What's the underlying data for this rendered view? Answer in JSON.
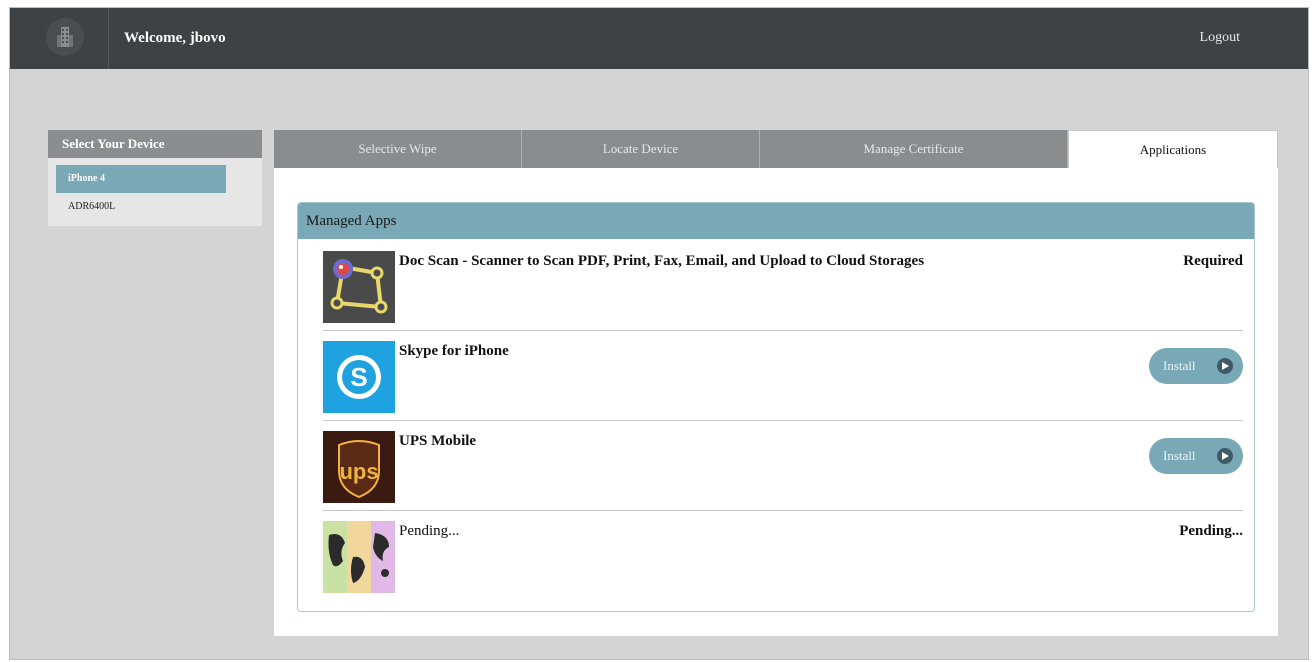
{
  "header": {
    "welcome": "Welcome, jbovo",
    "logout": "Logout"
  },
  "sidebar": {
    "title": "Select Your Device",
    "devices": [
      {
        "label": "iPhone 4",
        "selected": true
      },
      {
        "label": "ADR6400L",
        "selected": false
      }
    ]
  },
  "tabs": [
    {
      "label": "Selective Wipe",
      "active": false
    },
    {
      "label": "Locate Device",
      "active": false
    },
    {
      "label": "Manage Certificate",
      "active": false
    },
    {
      "label": "Applications",
      "active": true
    }
  ],
  "managed_apps": {
    "title": "Managed Apps",
    "apps": [
      {
        "name": "Doc Scan - Scanner to Scan PDF, Print, Fax, Email, and Upload to Cloud Storages",
        "status": "Required",
        "icon": "docscan-icon"
      },
      {
        "name": "Skype for iPhone",
        "action": "Install",
        "icon": "skype-icon"
      },
      {
        "name": "UPS Mobile",
        "action": "Install",
        "icon": "ups-icon"
      },
      {
        "name": "Pending...",
        "status": "Pending...",
        "icon": "map-app-icon"
      }
    ]
  },
  "colors": {
    "topbar": "#3e4245",
    "accent": "#79a8b6",
    "tab_inactive": "#8a8c8d",
    "background": "#d4d4d4"
  }
}
